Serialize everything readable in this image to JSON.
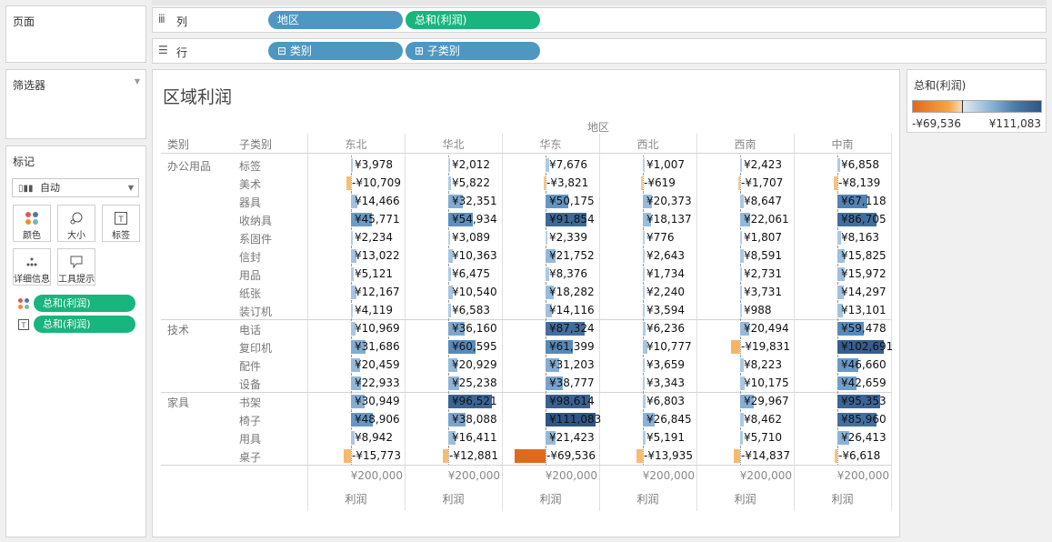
{
  "pages_label": "页面",
  "filters_label": "筛选器",
  "marks": {
    "title": "标记",
    "type": "自动",
    "buttons": [
      "颜色",
      "大小",
      "标签",
      "详细信息",
      "工具提示"
    ],
    "pills": [
      "总和(利润)",
      "总和(利润)"
    ]
  },
  "columns_shelf": {
    "label": "列",
    "pills": [
      "地区",
      "总和(利润)"
    ]
  },
  "rows_shelf": {
    "label": "行",
    "pills": [
      "⊟ 类别",
      "⊞ 子类别"
    ]
  },
  "legend": {
    "title": "总和(利润)",
    "min": "-¥69,536",
    "max": "¥111,083",
    "colors": {
      "negative": "#e06a1c",
      "positive": "#2f5586"
    }
  },
  "viz": {
    "title": "区域利润",
    "region_header": "地区",
    "category_header": "类别",
    "subcategory_header": "子类别",
    "regions": [
      "东北",
      "华北",
      "华东",
      "西北",
      "西南",
      "中南"
    ],
    "axis_tick": "¥200,000",
    "axis_title": "利润",
    "categories": [
      {
        "name": "办公用品",
        "subs": [
          "标签",
          "美术",
          "器具",
          "收纳具",
          "系固件",
          "信封",
          "用品",
          "纸张",
          "装订机"
        ]
      },
      {
        "name": "技术",
        "subs": [
          "电话",
          "复印机",
          "配件",
          "设备"
        ]
      },
      {
        "name": "家具",
        "subs": [
          "书架",
          "椅子",
          "用具",
          "桌子"
        ]
      }
    ]
  },
  "chart_data": {
    "type": "bar",
    "title": "区域利润",
    "regions": [
      "东北",
      "华北",
      "华东",
      "西北",
      "西南",
      "中南"
    ],
    "rows": [
      {
        "category": "办公用品",
        "subcategory": "标签",
        "values": [
          3978,
          2012,
          7676,
          1007,
          2423,
          6858
        ],
        "labels": [
          "¥3,978",
          "¥2,012",
          "¥7,676",
          "¥1,007",
          "¥2,423",
          "¥6,858"
        ]
      },
      {
        "category": "办公用品",
        "subcategory": "美术",
        "values": [
          -10709,
          5822,
          -3821,
          -619,
          -1707,
          -8139
        ],
        "labels": [
          "-¥10,709",
          "¥5,822",
          "-¥3,821",
          "-¥619",
          "-¥1,707",
          "-¥8,139"
        ]
      },
      {
        "category": "办公用品",
        "subcategory": "器具",
        "values": [
          14466,
          32351,
          50175,
          20373,
          8647,
          67118
        ],
        "labels": [
          "¥14,466",
          "¥32,351",
          "¥50,175",
          "¥20,373",
          "¥8,647",
          "¥67,118"
        ]
      },
      {
        "category": "办公用品",
        "subcategory": "收纳具",
        "values": [
          45771,
          54934,
          91854,
          18137,
          22061,
          86705
        ],
        "labels": [
          "¥45,771",
          "¥54,934",
          "¥91,854",
          "¥18,137",
          "¥22,061",
          "¥86,705"
        ]
      },
      {
        "category": "办公用品",
        "subcategory": "系固件",
        "values": [
          2234,
          3089,
          2339,
          776,
          1807,
          8163
        ],
        "labels": [
          "¥2,234",
          "¥3,089",
          "¥2,339",
          "¥776",
          "¥1,807",
          "¥8,163"
        ]
      },
      {
        "category": "办公用品",
        "subcategory": "信封",
        "values": [
          13022,
          10363,
          21752,
          2643,
          8591,
          15825
        ],
        "labels": [
          "¥13,022",
          "¥10,363",
          "¥21,752",
          "¥2,643",
          "¥8,591",
          "¥15,825"
        ]
      },
      {
        "category": "办公用品",
        "subcategory": "用品",
        "values": [
          5121,
          6475,
          8376,
          1734,
          2731,
          15972
        ],
        "labels": [
          "¥5,121",
          "¥6,475",
          "¥8,376",
          "¥1,734",
          "¥2,731",
          "¥15,972"
        ]
      },
      {
        "category": "办公用品",
        "subcategory": "纸张",
        "values": [
          12167,
          10540,
          18282,
          2240,
          3731,
          14297
        ],
        "labels": [
          "¥12,167",
          "¥10,540",
          "¥18,282",
          "¥2,240",
          "¥3,731",
          "¥14,297"
        ]
      },
      {
        "category": "办公用品",
        "subcategory": "装订机",
        "values": [
          4119,
          6583,
          14116,
          3594,
          988,
          13101
        ],
        "labels": [
          "¥4,119",
          "¥6,583",
          "¥14,116",
          "¥3,594",
          "¥988",
          "¥13,101"
        ]
      },
      {
        "category": "技术",
        "subcategory": "电话",
        "values": [
          10969,
          36160,
          87324,
          6236,
          20494,
          59478
        ],
        "labels": [
          "¥10,969",
          "¥36,160",
          "¥87,324",
          "¥6,236",
          "¥20,494",
          "¥59,478"
        ]
      },
      {
        "category": "技术",
        "subcategory": "复印机",
        "values": [
          31686,
          60595,
          61399,
          10777,
          -19831,
          102691
        ],
        "labels": [
          "¥31,686",
          "¥60,595",
          "¥61,399",
          "¥10,777",
          "-¥19,831",
          "¥102,691"
        ]
      },
      {
        "category": "技术",
        "subcategory": "配件",
        "values": [
          20459,
          20929,
          31203,
          3659,
          8223,
          46660
        ],
        "labels": [
          "¥20,459",
          "¥20,929",
          "¥31,203",
          "¥3,659",
          "¥8,223",
          "¥46,660"
        ]
      },
      {
        "category": "技术",
        "subcategory": "设备",
        "values": [
          22933,
          25238,
          38777,
          3343,
          10175,
          42659
        ],
        "labels": [
          "¥22,933",
          "¥25,238",
          "¥38,777",
          "¥3,343",
          "¥10,175",
          "¥42,659"
        ]
      },
      {
        "category": "家具",
        "subcategory": "书架",
        "values": [
          30949,
          96521,
          98614,
          6803,
          29967,
          95353
        ],
        "labels": [
          "¥30,949",
          "¥96,521",
          "¥98,614",
          "¥6,803",
          "¥29,967",
          "¥95,353"
        ]
      },
      {
        "category": "家具",
        "subcategory": "椅子",
        "values": [
          48906,
          38088,
          111083,
          26845,
          8462,
          85960
        ],
        "labels": [
          "¥48,906",
          "¥38,088",
          "¥111,083",
          "¥26,845",
          "¥8,462",
          "¥85,960"
        ]
      },
      {
        "category": "家具",
        "subcategory": "用具",
        "values": [
          8942,
          16411,
          21423,
          5191,
          5710,
          26413
        ],
        "labels": [
          "¥8,942",
          "¥16,411",
          "¥21,423",
          "¥5,191",
          "¥5,710",
          "¥26,413"
        ]
      },
      {
        "category": "家具",
        "subcategory": "桌子",
        "values": [
          -15773,
          -12881,
          -69536,
          -13935,
          -14837,
          -6618
        ],
        "labels": [
          "-¥15,773",
          "-¥12,881",
          "-¥69,536",
          "-¥13,935",
          "-¥14,837",
          "-¥6,618"
        ]
      }
    ],
    "xlabel": "利润",
    "color_range": [
      -69536,
      111083
    ]
  }
}
